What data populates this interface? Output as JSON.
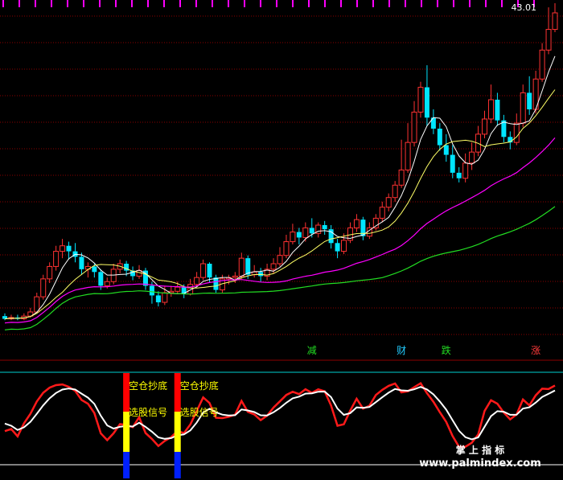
{
  "window": {
    "price_label": "43.01"
  },
  "colors": {
    "background": "#000000",
    "grid": "#8b0000",
    "candle_up": "#ff3232",
    "candle_down": "#00e5ff",
    "ma_short": "#ffffff",
    "ma_mid": "#ffff66",
    "ma_long": "#ff00ff",
    "ma_longest": "#22dd22",
    "osc_fast": "#ff1a1a",
    "osc_slow": "#ffffff",
    "signal_yellow": "#ffff00",
    "signal_red": "#ff0000",
    "signal_blue": "#0020ff",
    "ref_line": "#00d0d0",
    "tag_text_green": "#22dd22",
    "tag_text_cyan": "#22ccff",
    "tag_text_red": "#ff3b3b"
  },
  "tags": [
    {
      "text": "减",
      "color": "green",
      "index": 48
    },
    {
      "text": "财",
      "color": "cyan",
      "index": 62
    },
    {
      "text": "跌",
      "color": "green",
      "index": 69
    },
    {
      "text": "涨",
      "color": "red",
      "index": 83
    }
  ],
  "signals": [
    {
      "index": 19,
      "label_top": "空仓抄底",
      "label_bottom": "选股信号"
    },
    {
      "index": 27,
      "label_top": "空仓抄底",
      "label_bottom": "选股信号"
    }
  ],
  "watermark": {
    "line1": "掌 上 指 标",
    "line2": "www.palmindex.com"
  },
  "chart_data": {
    "type": "candlestick",
    "price_range": [
      20.8,
      43.9
    ],
    "candles": [
      [
        21.2,
        21.0,
        21.4,
        20.9
      ],
      [
        21.0,
        21.1,
        21.3,
        20.9
      ],
      [
        21.1,
        21.0,
        21.3,
        20.9
      ],
      [
        21.0,
        21.2,
        21.4,
        20.9
      ],
      [
        21.2,
        21.5,
        21.8,
        21.1
      ],
      [
        21.5,
        22.6,
        22.9,
        21.4
      ],
      [
        22.6,
        23.9,
        24.2,
        22.4
      ],
      [
        23.9,
        24.8,
        25.1,
        23.6
      ],
      [
        24.8,
        25.9,
        26.3,
        24.5
      ],
      [
        25.9,
        26.3,
        26.8,
        25.4
      ],
      [
        26.3,
        25.9,
        26.6,
        25.3
      ],
      [
        25.9,
        25.5,
        26.5,
        25.1
      ],
      [
        25.5,
        24.6,
        25.8,
        24.2
      ],
      [
        24.6,
        24.8,
        25.1,
        24.0
      ],
      [
        24.8,
        24.4,
        25.0,
        24.0
      ],
      [
        24.4,
        23.4,
        24.6,
        23.1
      ],
      [
        23.4,
        23.7,
        24.0,
        23.2
      ],
      [
        23.7,
        24.6,
        25.0,
        23.5
      ],
      [
        24.6,
        25.0,
        25.3,
        24.3
      ],
      [
        25.0,
        24.5,
        25.2,
        24.1
      ],
      [
        24.5,
        24.1,
        24.8,
        23.8
      ],
      [
        24.1,
        24.5,
        24.9,
        23.9
      ],
      [
        24.5,
        23.4,
        24.7,
        23.1
      ],
      [
        23.4,
        22.7,
        23.7,
        22.1
      ],
      [
        22.7,
        22.2,
        23.0,
        21.9
      ],
      [
        22.2,
        22.9,
        23.4,
        22.0
      ],
      [
        22.9,
        23.0,
        23.4,
        22.6
      ],
      [
        23.0,
        23.3,
        23.7,
        22.8
      ],
      [
        23.3,
        22.8,
        23.5,
        22.5
      ],
      [
        22.8,
        23.5,
        23.9,
        22.7
      ],
      [
        23.5,
        24.0,
        24.4,
        23.3
      ],
      [
        24.0,
        25.0,
        25.3,
        23.8
      ],
      [
        25.0,
        24.0,
        25.1,
        23.6
      ],
      [
        24.0,
        23.1,
        24.2,
        22.9
      ],
      [
        23.1,
        23.9,
        24.2,
        22.9
      ],
      [
        23.9,
        24.0,
        24.2,
        23.5
      ],
      [
        24.0,
        24.1,
        24.4,
        23.6
      ],
      [
        24.1,
        25.4,
        25.8,
        23.9
      ],
      [
        25.4,
        24.2,
        25.6,
        23.9
      ],
      [
        24.2,
        24.4,
        24.9,
        24.0
      ],
      [
        24.4,
        24.1,
        24.7,
        23.7
      ],
      [
        24.1,
        24.6,
        25.0,
        23.8
      ],
      [
        24.6,
        25.0,
        25.4,
        24.3
      ],
      [
        25.0,
        25.6,
        26.2,
        24.8
      ],
      [
        25.6,
        26.6,
        27.1,
        25.4
      ],
      [
        26.6,
        27.3,
        27.9,
        26.4
      ],
      [
        27.3,
        26.9,
        27.6,
        26.4
      ],
      [
        26.9,
        27.6,
        28.0,
        26.6
      ],
      [
        27.6,
        27.2,
        28.3,
        26.9
      ],
      [
        27.2,
        27.8,
        28.0,
        26.9
      ],
      [
        27.8,
        27.5,
        28.1,
        27.1
      ],
      [
        27.5,
        26.5,
        27.8,
        26.1
      ],
      [
        26.5,
        25.9,
        26.8,
        25.4
      ],
      [
        25.9,
        26.7,
        27.2,
        25.7
      ],
      [
        26.7,
        27.6,
        28.0,
        26.5
      ],
      [
        27.6,
        28.2,
        28.6,
        27.3
      ],
      [
        28.2,
        27.0,
        28.4,
        26.7
      ],
      [
        27.0,
        27.6,
        28.0,
        26.8
      ],
      [
        27.6,
        28.3,
        28.6,
        27.4
      ],
      [
        28.3,
        29.1,
        29.5,
        28.0
      ],
      [
        29.1,
        29.8,
        30.1,
        28.8
      ],
      [
        29.8,
        30.7,
        31.0,
        29.5
      ],
      [
        30.7,
        31.8,
        34.0,
        30.5
      ],
      [
        31.8,
        33.8,
        35.2,
        31.6
      ],
      [
        33.8,
        36.0,
        36.8,
        33.5
      ],
      [
        36.0,
        37.8,
        38.2,
        35.6
      ],
      [
        37.8,
        35.6,
        39.4,
        35.0
      ],
      [
        35.6,
        34.8,
        36.2,
        34.4
      ],
      [
        34.8,
        33.6,
        35.2,
        33.2
      ],
      [
        33.6,
        32.9,
        34.4,
        32.4
      ],
      [
        32.9,
        31.6,
        33.6,
        31.2
      ],
      [
        31.6,
        31.2,
        32.0,
        30.9
      ],
      [
        31.2,
        32.3,
        33.0,
        30.9
      ],
      [
        32.3,
        33.1,
        33.8,
        31.8
      ],
      [
        33.1,
        34.4,
        35.0,
        32.8
      ],
      [
        34.4,
        35.5,
        36.1,
        34.1
      ],
      [
        35.5,
        36.9,
        38.0,
        35.2
      ],
      [
        36.9,
        35.4,
        37.4,
        35.0
      ],
      [
        35.4,
        34.2,
        35.8,
        33.8
      ],
      [
        34.2,
        33.8,
        34.6,
        33.3
      ],
      [
        33.8,
        35.2,
        35.9,
        33.6
      ],
      [
        35.2,
        37.4,
        38.0,
        34.9
      ],
      [
        37.4,
        36.2,
        38.6,
        35.8
      ],
      [
        36.2,
        38.4,
        39.0,
        35.9
      ],
      [
        38.4,
        40.5,
        41.0,
        38.2
      ],
      [
        40.5,
        42.0,
        43.6,
        40.2
      ],
      [
        42.0,
        43.2,
        43.9,
        41.8
      ]
    ],
    "osc_range": [
      -5,
      105
    ]
  }
}
